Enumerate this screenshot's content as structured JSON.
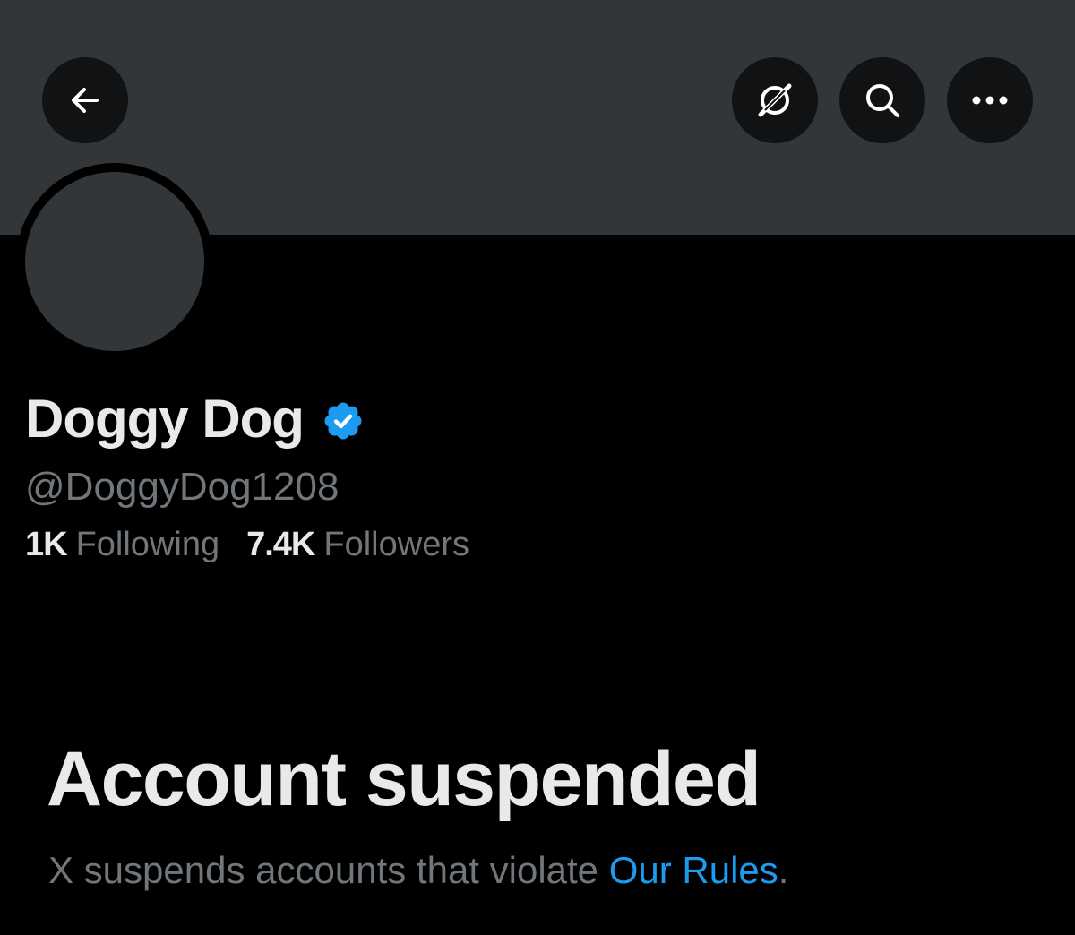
{
  "header": {
    "back_icon": "arrow-left-icon",
    "grok_icon": "grok-icon",
    "search_icon": "search-icon",
    "more_icon": "more-horizontal-icon"
  },
  "profile": {
    "display_name": "Doggy Dog",
    "verified": true,
    "verified_icon": "verified-badge-icon",
    "handle": "@DoggyDog1208",
    "following_count": "1K",
    "following_label": "Following",
    "followers_count": "7.4K",
    "followers_label": "Followers"
  },
  "suspension": {
    "title": "Account suspended",
    "message_prefix": "X suspends accounts that violate ",
    "link_text": "Our Rules",
    "message_suffix": "."
  },
  "colors": {
    "background": "#000000",
    "banner": "#333639",
    "button_bg": "#101214",
    "primary_text": "#e7e9ea",
    "secondary_text": "#71767b",
    "accent": "#1d9bf0"
  }
}
